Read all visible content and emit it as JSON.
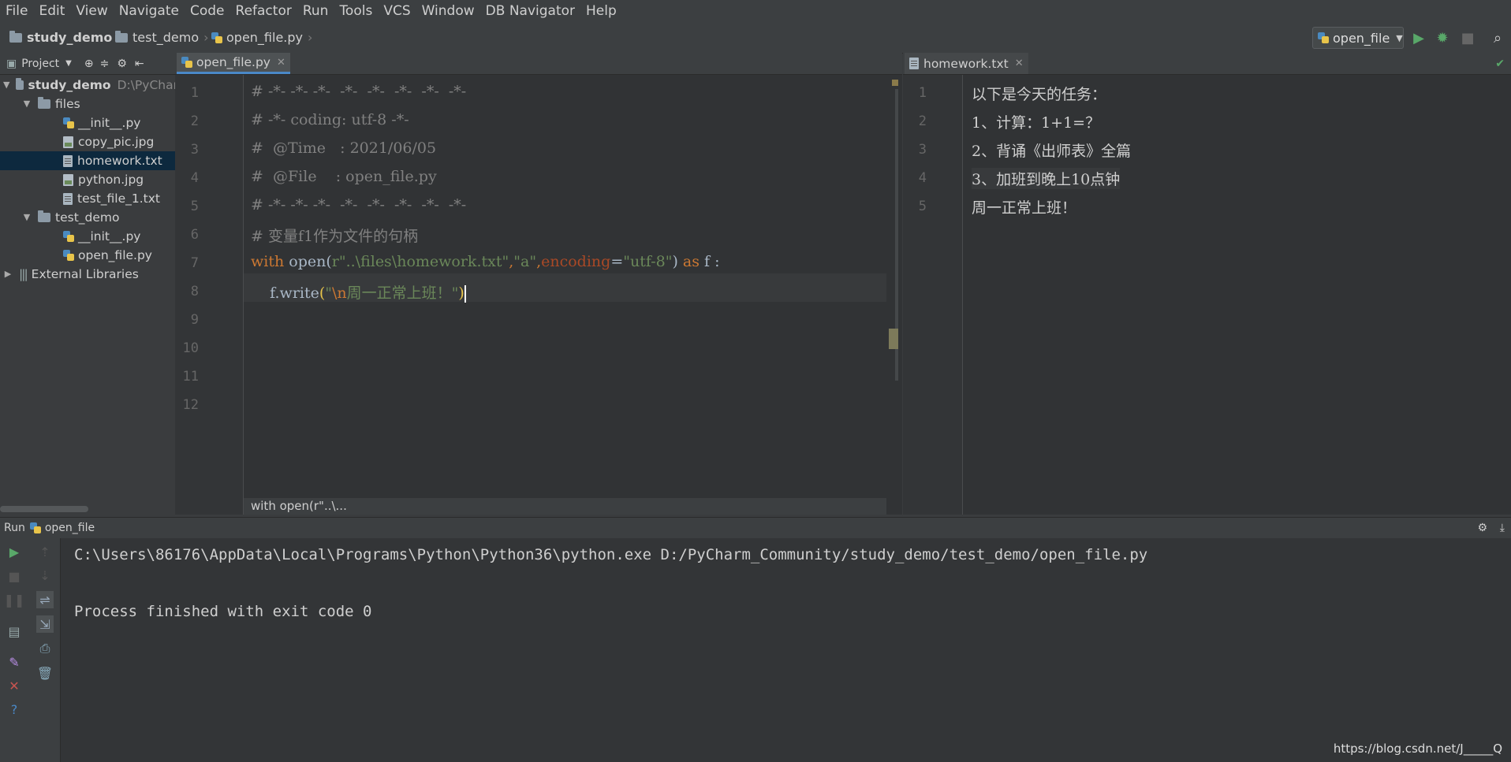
{
  "menu": [
    "File",
    "Edit",
    "View",
    "Navigate",
    "Code",
    "Refactor",
    "Run",
    "Tools",
    "VCS",
    "Window",
    "DB Navigator",
    "Help"
  ],
  "breadcrumb": [
    "study_demo",
    "test_demo",
    "open_file.py"
  ],
  "run_config": {
    "name": "open_file"
  },
  "project_panel": {
    "title": "Project",
    "root": {
      "name": "study_demo",
      "path": "D:\\PyChar"
    },
    "items": [
      {
        "label": "files"
      },
      {
        "label": "__init__.py"
      },
      {
        "label": "copy_pic.jpg"
      },
      {
        "label": "homework.txt"
      },
      {
        "label": "python.jpg"
      },
      {
        "label": "test_file_1.txt"
      },
      {
        "label": "test_demo"
      },
      {
        "label": "__init__.py"
      },
      {
        "label": "open_file.py"
      },
      {
        "label": "External Libraries"
      }
    ]
  },
  "editor_left": {
    "tab": "open_file.py",
    "line_numbers": [
      "1",
      "2",
      "3",
      "4",
      "5",
      "6",
      "7",
      "8",
      "9",
      "10",
      "11",
      "12"
    ],
    "lines": {
      "l1": "# -*- -*- -*-  -*-  -*-  -*-  -*-  -*-",
      "l2": "# -*- coding: utf-8 -*-",
      "l3": "#  @Time   : 2021/06/05",
      "l4": "#  @File    : open_file.py",
      "l5": "# -*- -*- -*-  -*-  -*-  -*-  -*-  -*-",
      "l6": "# 变量f1作为文件的句柄",
      "l7": {
        "kw_with": "with",
        "fn_open": " open",
        "p1": "(",
        "str_path": "r\"..\\files\\homework.txt\"",
        "comma1": ",",
        "str_mode": "\"a\"",
        "comma2": ",",
        "param": "encoding",
        "eq": "=",
        "str_enc": "\"utf-8\"",
        "p2": ") ",
        "kw_as": "as",
        "var": " f :"
      },
      "l8": {
        "indent": "    f.write",
        "p1": "(",
        "str_q1": "\"",
        "esc": "\\n",
        "str_text": "周一正常上班！\"",
        "p2": ")"
      }
    },
    "breadcrumb": "with open(r\"..\\..."
  },
  "editor_right": {
    "tab": "homework.txt",
    "line_numbers": [
      "1",
      "2",
      "3",
      "4",
      "5"
    ],
    "lines": [
      "以下是今天的任务：",
      "1、计算：1+1=？",
      "2、背诵《出师表》全篇",
      "3、加班到晚上10点钟",
      "周一正常上班！"
    ]
  },
  "run_panel": {
    "label": "Run",
    "config": "open_file",
    "console": [
      "C:\\Users\\86176\\AppData\\Local\\Programs\\Python\\Python36\\python.exe D:/PyCharm_Community/study_demo/test_demo/open_file.py",
      "",
      "Process finished with exit code 0"
    ]
  },
  "watermark": "https://blog.csdn.net/J_____Q",
  "colors": {
    "accent": "#4a88c7",
    "keyword": "#cc7832",
    "string": "#6a8759",
    "run_green": "#59a869",
    "stop_red": "#c75450"
  }
}
